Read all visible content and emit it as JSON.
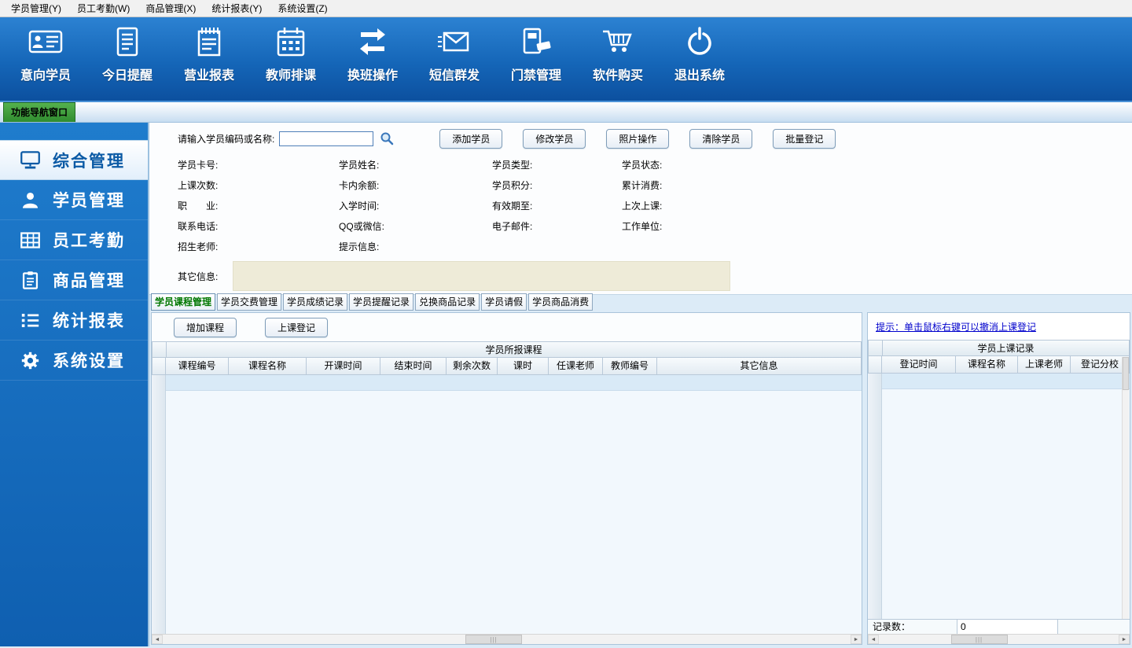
{
  "colors": {
    "toolbar_blue": "#1566b8",
    "sidebar_blue": "#1a74c6",
    "nav_tab_green": "#3ba13b",
    "active_tab_text": "#007700",
    "tip_blue": "#0000cc",
    "note_beige": "#eeebd8"
  },
  "menu": {
    "items": [
      "学员管理(Y)",
      "员工考勤(W)",
      "商品管理(X)",
      "统计报表(Y)",
      "系统设置(Z)"
    ]
  },
  "toolbar": {
    "items": [
      {
        "label": "意向学员",
        "icon": "id-card-icon"
      },
      {
        "label": "今日提醒",
        "icon": "document-icon"
      },
      {
        "label": "营业报表",
        "icon": "notepad-icon"
      },
      {
        "label": "教师排课",
        "icon": "calendar-icon"
      },
      {
        "label": "换班操作",
        "icon": "swap-arrows-icon"
      },
      {
        "label": "短信群发",
        "icon": "envelope-icon"
      },
      {
        "label": "门禁管理",
        "icon": "access-card-icon"
      },
      {
        "label": "软件购买",
        "icon": "cart-icon"
      },
      {
        "label": "退出系统",
        "icon": "power-icon"
      }
    ]
  },
  "nav_tab": "功能导航窗口",
  "sidebar": {
    "items": [
      {
        "label": "综合管理",
        "icon": "monitor-icon",
        "active": true
      },
      {
        "label": "学员管理",
        "icon": "person-icon",
        "active": false
      },
      {
        "label": "员工考勤",
        "icon": "grid-icon",
        "active": false
      },
      {
        "label": "商品管理",
        "icon": "clipboard-icon",
        "active": false
      },
      {
        "label": "统计报表",
        "icon": "list-icon",
        "active": false
      },
      {
        "label": "系统设置",
        "icon": "gear-icon",
        "active": false
      }
    ]
  },
  "search": {
    "label": "请输入学员编码或名称:",
    "value": "",
    "buttons": [
      "添加学员",
      "修改学员",
      "照片操作",
      "清除学员",
      "批量登记"
    ]
  },
  "info": {
    "rows": [
      [
        "学员卡号:",
        "学员姓名:",
        "学员类型:",
        "学员状态:"
      ],
      [
        "上课次数:",
        "卡内余额:",
        "学员积分:",
        "累计消费:"
      ],
      [
        "职　　业:",
        "入学时间:",
        "有效期至:",
        "上次上课:"
      ],
      [
        "联系电话:",
        "QQ或微信:",
        "电子邮件:",
        "工作单位:"
      ],
      [
        "招生老师:",
        "提示信息:"
      ]
    ],
    "other_label": "其它信息:"
  },
  "tabs": [
    "学员课程管理",
    "学员交费管理",
    "学员成绩记录",
    "学员提醒记录",
    "兑换商品记录",
    "学员请假",
    "学员商品消费"
  ],
  "course_panel": {
    "buttons": [
      "增加课程",
      "上课登记"
    ],
    "table_title": "学员所报课程",
    "columns": [
      "课程编号",
      "课程名称",
      "开课时间",
      "结束时间",
      "剩余次数",
      "课时",
      "任课老师",
      "教师编号",
      "其它信息"
    ]
  },
  "record_panel": {
    "tip": "提示：单击鼠标右键可以撤消上课登记",
    "table_title": "学员上课记录",
    "columns": [
      "登记时间",
      "课程名称",
      "上课老师",
      "登记分校"
    ],
    "footer_label": "记录数：",
    "footer_value": "0"
  }
}
